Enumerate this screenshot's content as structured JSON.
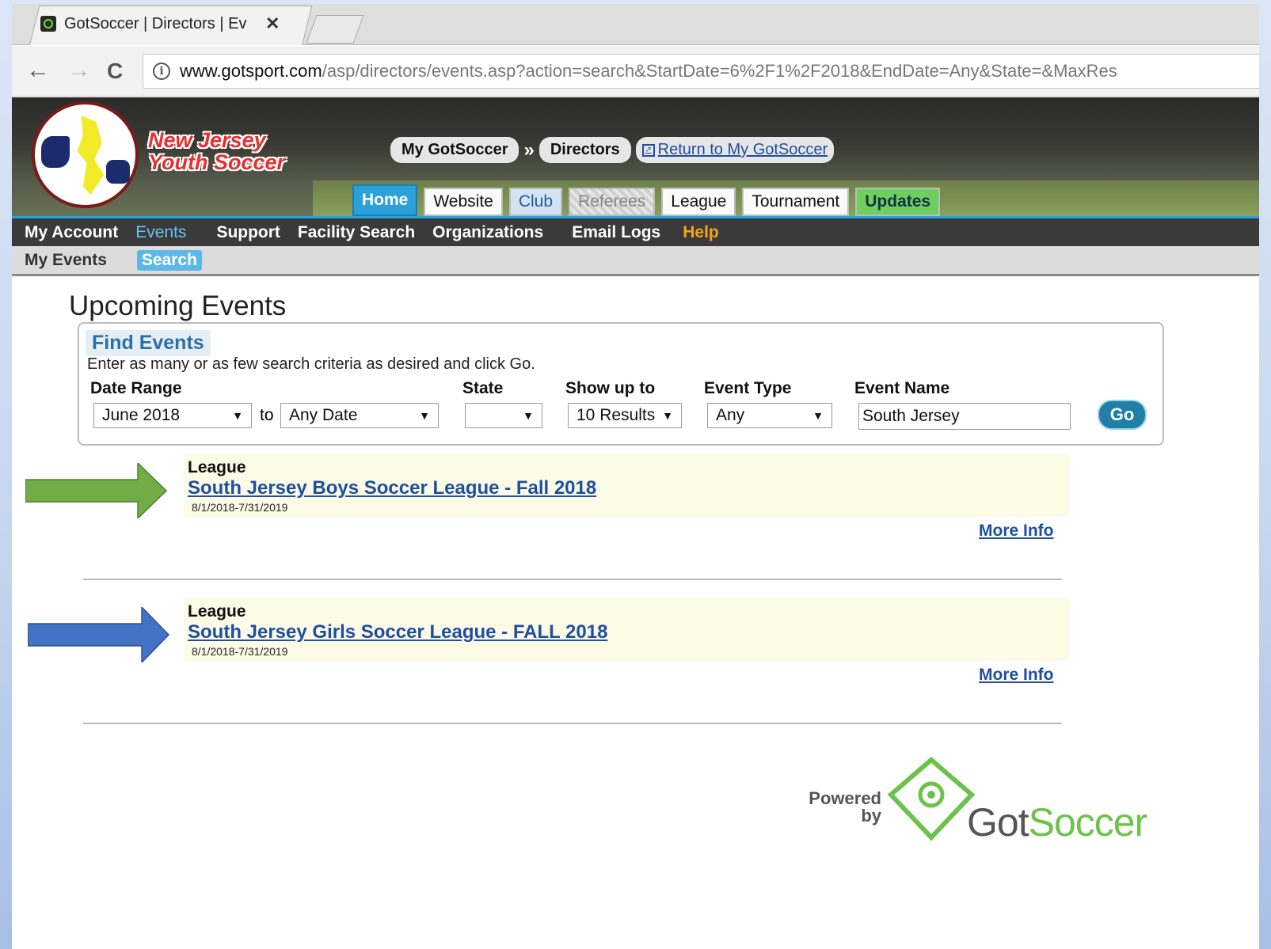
{
  "browser": {
    "tab_title": "GotSoccer | Directors | Ev",
    "tab_close": "✕",
    "url_host": "www.gotsport.com",
    "url_path": "/asp/directors/events.asp?action=search&StartDate=6%2F1%2F2018&EndDate=Any&State=&MaxRes",
    "nav": {
      "back": "←",
      "forward": "→",
      "reload": "C"
    },
    "info_icon": "i"
  },
  "header": {
    "logo_line1": "New Jersey",
    "logo_line2": "Youth Soccer",
    "crumbs": [
      "My GotSoccer",
      "Directors"
    ],
    "crumb_arrow": "»",
    "return_link": "Return to My GotSoccer",
    "tabs": [
      "Home",
      "Website",
      "Club",
      "Referees",
      "League",
      "Tournament",
      "Updates"
    ]
  },
  "mainnav": [
    "My Account",
    "Events",
    "Support",
    "Facility Search",
    "Organizations",
    "Email Logs",
    "Help"
  ],
  "subnav": [
    "My Events",
    "Search"
  ],
  "page": {
    "title": "Upcoming Events"
  },
  "find": {
    "title": "Find Events",
    "hint": "Enter as many or as few search criteria as desired and click Go.",
    "labels": {
      "date_range": "Date Range",
      "state": "State",
      "show_up_to": "Show up to",
      "event_type": "Event Type",
      "event_name": "Event Name"
    },
    "start_date": "June 2018",
    "to": "to",
    "end_date": "Any Date",
    "state": "",
    "show": "10 Results",
    "event_type": "Any",
    "event_name": "South Jersey",
    "go": "Go"
  },
  "events": [
    {
      "type": "League",
      "name": "South Jersey Boys Soccer League - Fall 2018",
      "dates": "8/1/2018-7/31/2019",
      "more": "More Info",
      "arrow_color": "#70ad47"
    },
    {
      "type": "League",
      "name": "South Jersey Girls Soccer League - FALL 2018",
      "dates": "8/1/2018-7/31/2019",
      "more": "More Info",
      "arrow_color": "#4472c4"
    }
  ],
  "footer": {
    "powered": "Powered",
    "by": "by",
    "brand_a": "Got",
    "brand_b": "Soccer"
  }
}
